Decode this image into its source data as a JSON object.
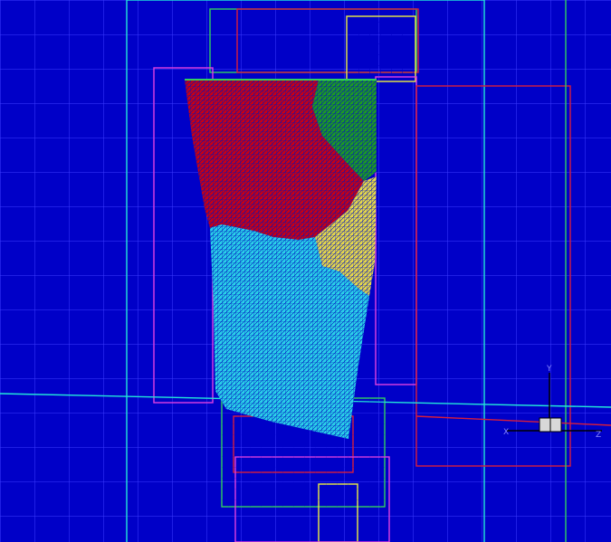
{
  "viewport": {
    "background_color": "#0000c8",
    "grid_color": "#3c3cff"
  },
  "mesh_regions": [
    {
      "name": "red-partition",
      "color": "#c80014",
      "line_color": "#ff2a3a"
    },
    {
      "name": "green-partition",
      "color": "#1c9a24",
      "line_color": "#4cd84c"
    },
    {
      "name": "yellow-partition",
      "color": "#e6d84a",
      "line_color": "#fff27a"
    },
    {
      "name": "cyan-partition",
      "color": "#2ad0e8",
      "line_color": "#7ff4ff"
    }
  ],
  "block_colors": {
    "cyan": "#22e8d8",
    "magenta": "#e040e0",
    "red": "#d81e3c",
    "yellow": "#f0f040",
    "green": "#30d060"
  },
  "axis_triad": {
    "y_label": "Y",
    "x_label": "X",
    "z_label": "Z"
  }
}
